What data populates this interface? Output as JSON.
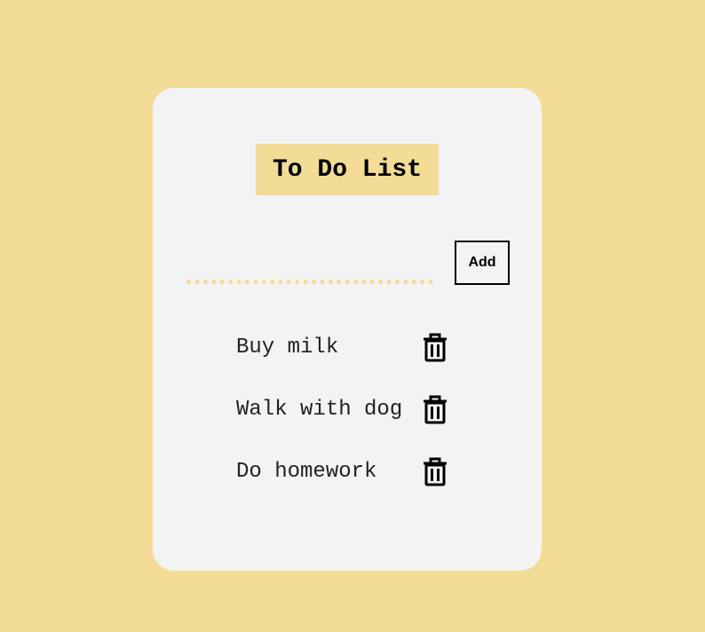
{
  "app": {
    "title": "To Do List"
  },
  "form": {
    "input_value": "",
    "input_placeholder": "",
    "add_label": "Add"
  },
  "todos": [
    {
      "text": "Buy milk"
    },
    {
      "text": "Walk with dog"
    },
    {
      "text": "Do homework"
    }
  ],
  "icons": {
    "delete": "trash-icon"
  },
  "colors": {
    "background": "#f2dc96",
    "card": "#f3f3f3",
    "accent": "#f2dc96"
  }
}
